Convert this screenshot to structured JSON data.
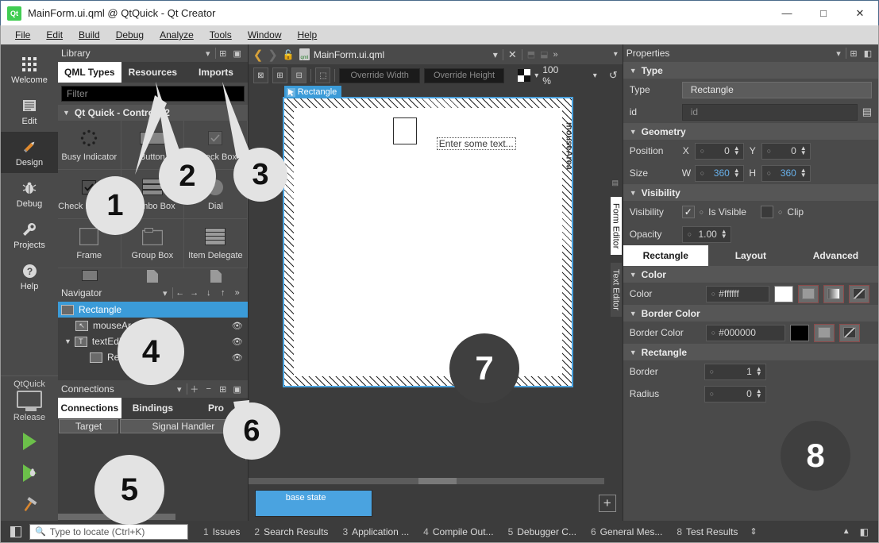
{
  "window": {
    "title": "MainForm.ui.qml @ QtQuick - Qt Creator",
    "app_icon": "qt-icon",
    "minimize": "—",
    "maximize": "□",
    "close": "✕"
  },
  "menubar": [
    {
      "label": "File",
      "accel": "F"
    },
    {
      "label": "Edit",
      "accel": "E"
    },
    {
      "label": "Build",
      "accel": "B"
    },
    {
      "label": "Debug",
      "accel": "D"
    },
    {
      "label": "Analyze",
      "accel": "A"
    },
    {
      "label": "Tools",
      "accel": "T"
    },
    {
      "label": "Window",
      "accel": "W"
    },
    {
      "label": "Help",
      "accel": "H"
    }
  ],
  "modebar": {
    "modes": [
      {
        "label": "Welcome",
        "icon": "grid-icon"
      },
      {
        "label": "Edit",
        "icon": "lines-icon"
      },
      {
        "label": "Design",
        "icon": "pencil-icon",
        "active": true
      },
      {
        "label": "Debug",
        "icon": "bug-icon"
      },
      {
        "label": "Projects",
        "icon": "wrench-icon"
      },
      {
        "label": "Help",
        "icon": "question-icon"
      }
    ],
    "kit_name": "QtQuick",
    "build_config": "Release",
    "run_label": "run-button",
    "debug_label": "debug-button",
    "build_label": "build-button"
  },
  "library": {
    "panel_title": "Library",
    "tabs": [
      {
        "label": "QML Types",
        "active": true
      },
      {
        "label": "Resources",
        "active": false
      },
      {
        "label": "Imports",
        "active": false
      }
    ],
    "filter_placeholder": "Filter",
    "section": "Qt Quick - Controls 2",
    "items": [
      {
        "name": "Busy Indicator",
        "icon": "busy-indicator-icon"
      },
      {
        "name": "Button",
        "icon": "button-icon"
      },
      {
        "name": "Check Box",
        "icon": "checkbox-icon"
      },
      {
        "name": "Check Delegate",
        "icon": "check-delegate-icon"
      },
      {
        "name": "Combo Box",
        "icon": "combobox-icon"
      },
      {
        "name": "Dial",
        "icon": "dial-icon"
      },
      {
        "name": "Frame",
        "icon": "frame-icon"
      },
      {
        "name": "Group Box",
        "icon": "groupbox-icon"
      },
      {
        "name": "Item Delegate",
        "icon": "item-delegate-icon"
      }
    ]
  },
  "navigator": {
    "panel_title": "Navigator",
    "toolbar_icons": [
      "arrow-left-icon",
      "arrow-right-icon",
      "arrow-down-icon",
      "arrow-up-icon",
      "more-icon"
    ],
    "nodes": [
      {
        "label": "Rectangle",
        "selected": true,
        "indent": 0,
        "eye": false,
        "alias": false
      },
      {
        "label": "mouseArea",
        "selected": false,
        "indent": 1,
        "eye": true,
        "alias": true
      },
      {
        "label": "textEdit",
        "selected": false,
        "indent": 1,
        "eye": true,
        "alias": true
      },
      {
        "label": "Rec...gle",
        "selected": false,
        "indent": 2,
        "eye": true,
        "alias": true
      }
    ]
  },
  "connections": {
    "panel_title": "Connections",
    "toolbar_icons": [
      "plus-icon",
      "minus-icon",
      "split-icon",
      "menu-icon"
    ],
    "tabs": [
      {
        "label": "Connections",
        "active": true
      },
      {
        "label": "Bindings",
        "active": false
      },
      {
        "label": "Pro",
        "active": false
      }
    ],
    "columns": [
      "Target",
      "Signal Handler"
    ]
  },
  "form_editor": {
    "document_name": "MainForm.ui.qml",
    "toolbar_icons": [
      "no-snapping-icon",
      "snap-anchors-icon",
      "snap-items-icon",
      "select-only-items-icon"
    ],
    "override_width_placeholder": "Override Width",
    "override_height_placeholder": "Override Height",
    "zoom": "100 %",
    "reset_icon": "reset-view-icon",
    "close_icon": "close-document-icon",
    "split_icons": [
      "split-horizontal-icon",
      "split-vertical-icon",
      "more-icon"
    ],
    "canvas": {
      "badge_label": "Rectangle",
      "textedit_text": "Enter some text...",
      "mousearea_label": "mouseArea"
    },
    "vertical_tabs": [
      {
        "label": "Form Editor",
        "active": true
      },
      {
        "label": "Text Editor",
        "active": false
      }
    ],
    "states": {
      "base_state": "base state",
      "add_label": "+"
    }
  },
  "properties": {
    "panel_title": "Properties",
    "header_icons": [
      "split-icon",
      "collapse-icon"
    ],
    "type_section": "Type",
    "type_label": "Type",
    "type_value": "Rectangle",
    "id_label": "id",
    "id_placeholder": "id",
    "id_icon": "text-icon",
    "geometry_section": "Geometry",
    "position_label": "Position",
    "position_x_axis": "X",
    "position_x": "0",
    "position_y_axis": "Y",
    "position_y": "0",
    "size_label": "Size",
    "size_w_axis": "W",
    "size_w": "360",
    "size_h_axis": "H",
    "size_h": "360",
    "visibility_section": "Visibility",
    "visibility_label": "Visibility",
    "is_visible_label": "Is Visible",
    "is_visible_checked": true,
    "clip_label": "Clip",
    "clip_checked": false,
    "opacity_label": "Opacity",
    "opacity_value": "1.00",
    "tabs": [
      {
        "label": "Rectangle",
        "active": true
      },
      {
        "label": "Layout",
        "active": false
      },
      {
        "label": "Advanced",
        "active": false
      }
    ],
    "color_section": "Color",
    "color_label": "Color",
    "color_value": "#ffffff",
    "border_color_section": "Border Color",
    "border_color_label": "Border Color",
    "border_color_value": "#000000",
    "rectangle_section": "Rectangle",
    "border_label": "Border",
    "border_value": "1",
    "radius_label": "Radius",
    "radius_value": "0"
  },
  "statusbar": {
    "sidebar_icon": "toggle-sidebar-icon",
    "locator_icon": "search-icon",
    "locator_placeholder": "Type to locate (Ctrl+K)",
    "output_tabs": [
      {
        "num": "1",
        "label": "Issues"
      },
      {
        "num": "2",
        "label": "Search Results"
      },
      {
        "num": "3",
        "label": "Application ..."
      },
      {
        "num": "4",
        "label": "Compile Out..."
      },
      {
        "num": "5",
        "label": "Debugger C..."
      },
      {
        "num": "6",
        "label": "General Mes..."
      },
      {
        "num": "8",
        "label": "Test Results"
      }
    ],
    "updown_icon": "up-down-icon",
    "collapse_icon": "collapse-output-icon",
    "panel_icon": "output-panel-icon"
  },
  "callouts": [
    {
      "num": "1",
      "style": "light"
    },
    {
      "num": "2",
      "style": "light"
    },
    {
      "num": "3",
      "style": "light"
    },
    {
      "num": "4",
      "style": "light"
    },
    {
      "num": "5",
      "style": "light"
    },
    {
      "num": "6",
      "style": "light"
    },
    {
      "num": "7",
      "style": "dark"
    },
    {
      "num": "8",
      "style": "dark"
    }
  ]
}
